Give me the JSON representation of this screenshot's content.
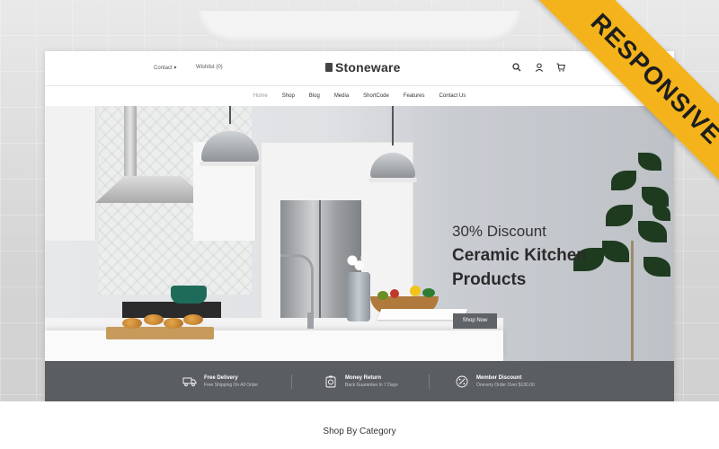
{
  "header": {
    "contact_label": "Contact",
    "wishlist_label": "Wishlist (0)",
    "logo_text": "Stoneware",
    "icons": [
      "search-icon",
      "user-icon",
      "cart-icon"
    ]
  },
  "nav": {
    "items": [
      "Home",
      "Shop",
      "Blog",
      "Media",
      "ShortCode",
      "Features",
      "Contact Us"
    ],
    "active_index": 0
  },
  "hero": {
    "subtitle": "30% Discount",
    "title": "Ceramic Kitchen Products",
    "button_label": "Shop Now"
  },
  "features": [
    {
      "icon": "truck-icon",
      "title": "Free Delivery",
      "desc": "Free Shipping On All Order"
    },
    {
      "icon": "money-return-icon",
      "title": "Money Return",
      "desc": "Back Guarantee In 7 Days"
    },
    {
      "icon": "discount-icon",
      "title": "Member Discount",
      "desc": "Onevery Order Over $130.00"
    }
  ],
  "section": {
    "shop_by_category": "Shop By Category"
  },
  "ribbon": {
    "text": "RESPONSIVE"
  },
  "colors": {
    "ribbon": "#f4b31b",
    "feature_bar": "#5a5e63",
    "button": "#5f6368"
  }
}
